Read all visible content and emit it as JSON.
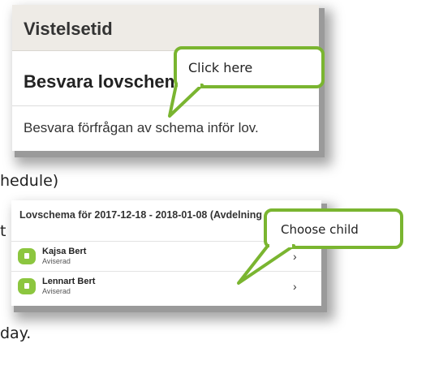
{
  "background": {
    "line1": "hedule)",
    "line2_suffix": "t",
    "line3": "day."
  },
  "card_request": {
    "header_title": "Vistelsetid",
    "subtitle": "Besvara lovschema",
    "description": "Besvara förfrågan av schema inför lov."
  },
  "card_children": {
    "title": "Lovschema för 2017-12-18 - 2018-01-08 (Avdelning Gul)",
    "rows": [
      {
        "name": "Kajsa Bert",
        "status": "Aviserad"
      },
      {
        "name": "Lennart Bert",
        "status": "Aviserad"
      }
    ]
  },
  "callouts": {
    "click_here": "Click here",
    "choose_child": "Choose child"
  },
  "colors": {
    "callout_border": "#7ab530",
    "avatar": "#8cc63f",
    "header_bg": "#eeebe6"
  },
  "icons": {
    "row_avatar": "child-avatar-icon",
    "row_chevron": "chevron-right-icon"
  }
}
